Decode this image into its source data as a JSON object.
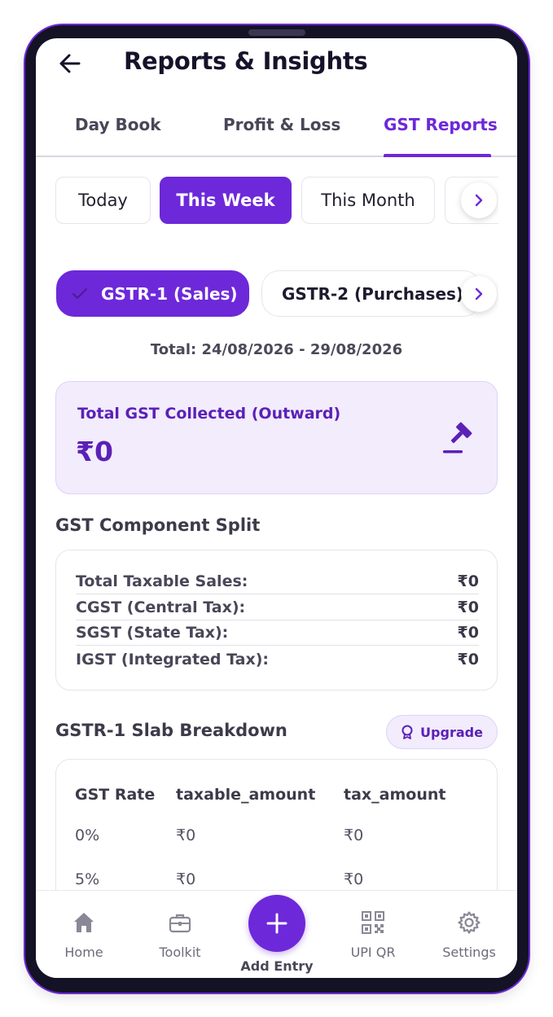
{
  "header": {
    "title": "Reports & Insights",
    "back_icon": "arrow-left-icon"
  },
  "tabs": [
    {
      "label": "Day Book",
      "active": false
    },
    {
      "label": "Profit & Loss",
      "active": false
    },
    {
      "label": "GST Reports",
      "active": true
    }
  ],
  "date_filters": [
    "Today",
    "This Week",
    "This Month"
  ],
  "date_filter_selected": "This Week",
  "gstr_filters": [
    "GSTR-1 (Sales)",
    "GSTR-2 (Purchases)"
  ],
  "gstr_filter_selected": "GSTR-1 (Sales)",
  "range_text": "Total: 24/08/2026 - 29/08/2026",
  "summary": {
    "label": "Total GST Collected (Outward)",
    "value": "₹0",
    "icon": "gavel-icon"
  },
  "component_split": {
    "title": "GST Component Split",
    "rows": [
      {
        "label": "Total Taxable Sales:",
        "value": "₹0"
      },
      {
        "label": "CGST (Central Tax):",
        "value": "₹0"
      },
      {
        "label": "SGST (State Tax):",
        "value": "₹0"
      },
      {
        "label": "IGST (Integrated Tax):",
        "value": "₹0"
      }
    ]
  },
  "slab": {
    "title": "GSTR-1 Slab Breakdown",
    "upgrade_label": "Upgrade",
    "columns": [
      "GST Rate",
      "taxable_amount",
      "tax_amount"
    ],
    "rows": [
      [
        "0%",
        "₹0",
        "₹0"
      ],
      [
        "5%",
        "₹0",
        "₹0"
      ]
    ]
  },
  "bottom_nav": {
    "items": [
      {
        "label": "Home",
        "icon": "home-icon"
      },
      {
        "label": "Toolkit",
        "icon": "briefcase-icon"
      },
      {
        "label": "UPI QR",
        "icon": "qr-code-icon"
      },
      {
        "label": "Settings",
        "icon": "gear-icon"
      }
    ],
    "fab_label": "Add Entry",
    "fab_icon": "plus-icon"
  },
  "colors": {
    "accent": "#6d28d9",
    "accent_light": "#f2ecfd",
    "text_dark": "#15132a"
  }
}
